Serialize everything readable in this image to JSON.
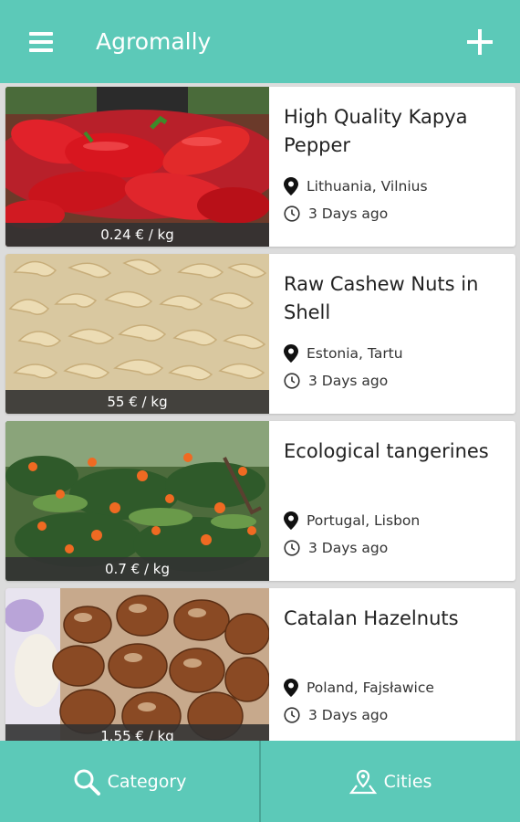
{
  "app_bar": {
    "title": "Agromally",
    "menu_icon": "hamburger-menu-icon",
    "add_icon": "plus-icon"
  },
  "listings": [
    {
      "title": "High Quality Kapya Pepper",
      "price": "0.24 € / kg",
      "location": "Lithuania, Vilnius",
      "posted": "3 Days ago",
      "image": "red-peppers"
    },
    {
      "title": "Raw Cashew Nuts in Shell",
      "price": "55 € / kg",
      "location": "Estonia, Tartu",
      "posted": "3 Days ago",
      "image": "cashew-nuts"
    },
    {
      "title": "Ecological tangerines",
      "price": "0.7 € / kg",
      "location": "Portugal, Lisbon",
      "posted": "3 Days ago",
      "image": "tangerine-tree"
    },
    {
      "title": "Catalan Hazelnuts",
      "price": "1.55 € / kg",
      "location": "Poland, Fajsławice",
      "posted": "3 Days ago",
      "image": "hazelnuts"
    }
  ],
  "bottom_nav": {
    "category_label": "Category",
    "cities_label": "Cities"
  },
  "colors": {
    "primary": "#5cc9b8",
    "price_bar": "#333333"
  }
}
